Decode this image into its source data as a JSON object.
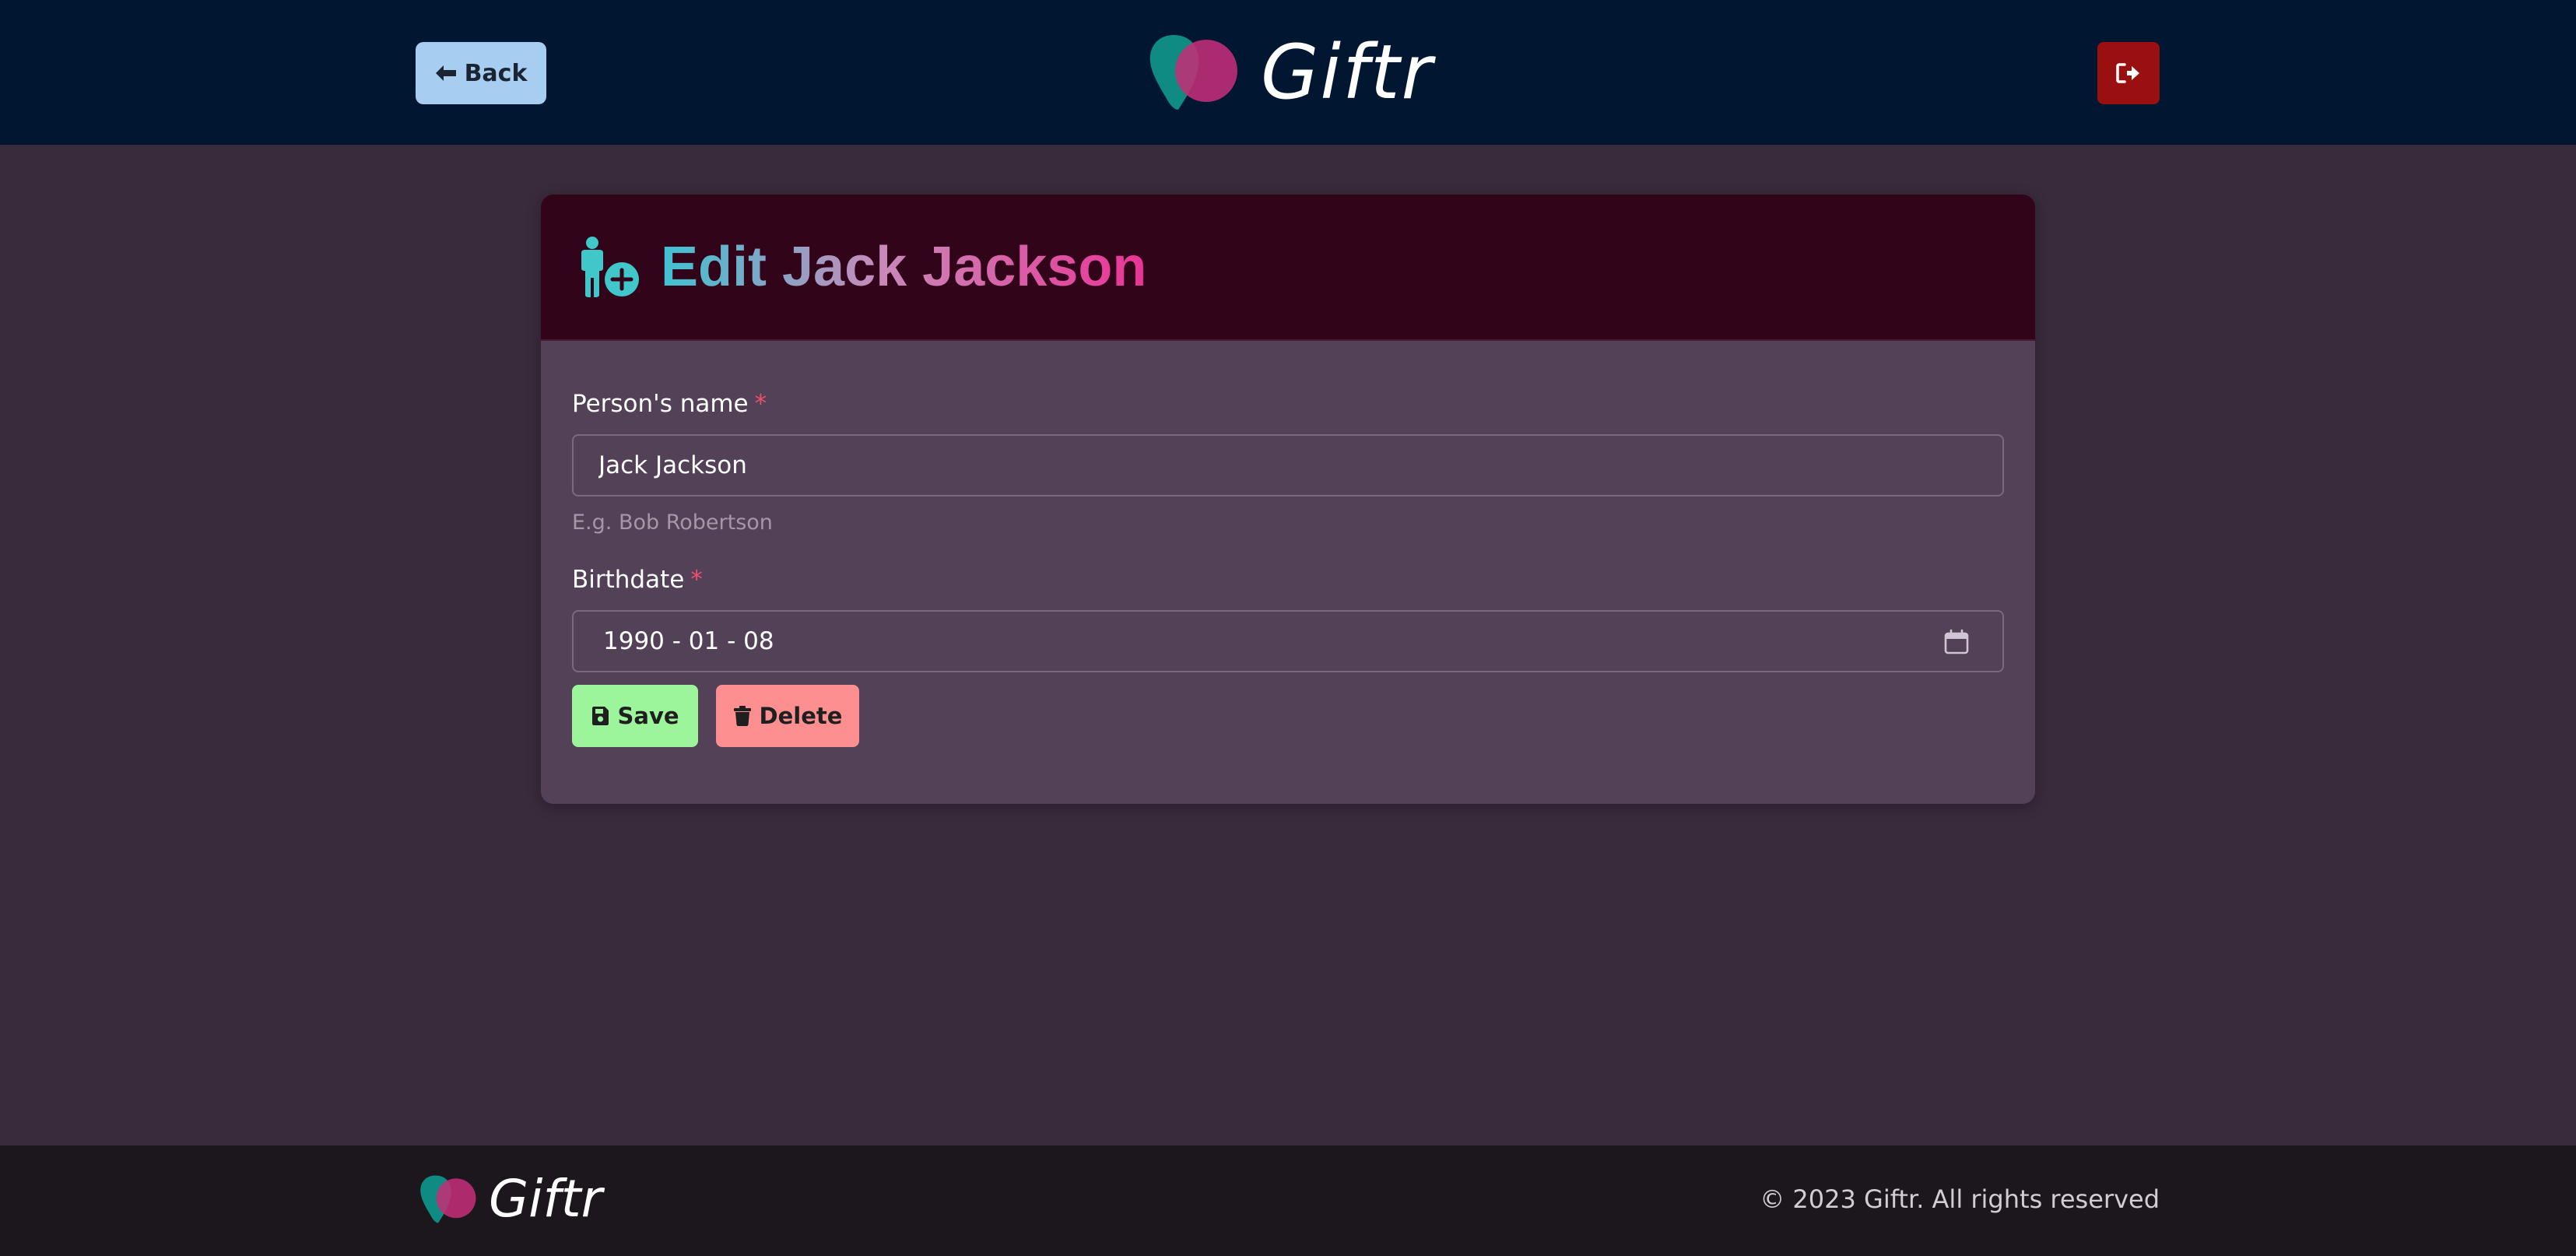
{
  "app": {
    "brand": "Giftr"
  },
  "header": {
    "back_label": "Back",
    "colors": {
      "bar": "#011731",
      "back_button": "#a7cdf1",
      "logout_button": "#9a0f0f"
    }
  },
  "card": {
    "title": "Edit Jack Jackson",
    "icon": "person-add-icon",
    "form": {
      "name_label": "Person's name",
      "required_mark": "*",
      "name_value": "Jack Jackson",
      "name_help": "E.g. Bob Robertson",
      "birthdate_label": "Birthdate",
      "birthdate_value": "1990 - 01 - 08"
    },
    "buttons": {
      "save_label": "Save",
      "delete_label": "Delete"
    },
    "colors": {
      "save": "#9cf59a",
      "delete": "#fd8f91",
      "title_gradient": [
        "#3fc2d2",
        "#c88ab9",
        "#ea3495"
      ]
    }
  },
  "footer": {
    "copyright": "© 2023 Giftr. All rights reserved"
  }
}
